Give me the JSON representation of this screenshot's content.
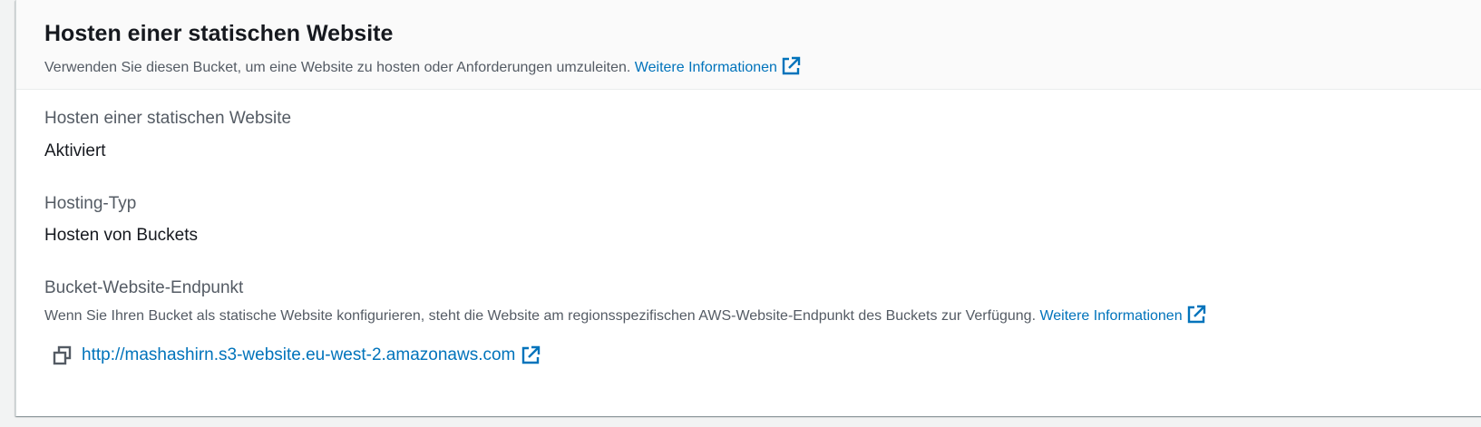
{
  "section": {
    "title": "Hosten einer statischen Website",
    "description": "Verwenden Sie diesen Bucket, um eine Website zu hosten oder Anforderungen umzuleiten.",
    "info_link": "Weitere Informationen"
  },
  "fields": {
    "hosting": {
      "label": "Hosten einer statischen Website",
      "value": "Aktiviert"
    },
    "hosting_type": {
      "label": "Hosting-Typ",
      "value": "Hosten von Buckets"
    },
    "endpoint": {
      "label": "Bucket-Website-Endpunkt",
      "description": "Wenn Sie Ihren Bucket als statische Website konfigurieren, steht die Website am regionsspezifischen AWS-Website-Endpunkt des Buckets zur Verfügung.",
      "info_link": "Weitere Informationen",
      "url": "http://mashashirn.s3-website.eu-west-2.amazonaws.com"
    }
  },
  "icons": {
    "external": "external-link-icon",
    "copy": "copy-icon"
  },
  "colors": {
    "link": "#0073bb",
    "text": "#16191f",
    "muted": "#545b64"
  }
}
